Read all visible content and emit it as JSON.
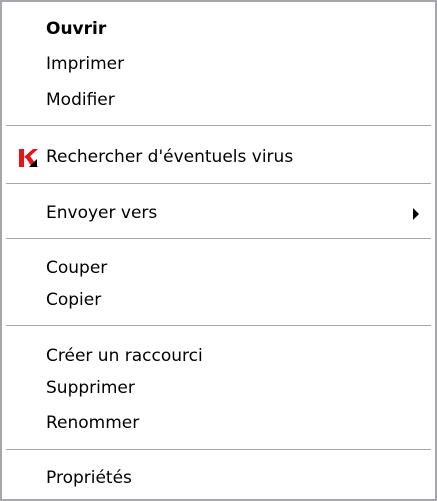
{
  "context_menu": {
    "items": [
      {
        "label": "Ouvrir"
      },
      {
        "label": "Imprimer"
      },
      {
        "label": "Modifier"
      },
      {
        "label": "Rechercher d'éventuels virus",
        "icon": "kaspersky-k-icon"
      },
      {
        "label": "Envoyer vers",
        "icon": "submenu-arrow-icon"
      },
      {
        "label": "Couper"
      },
      {
        "label": "Copier"
      },
      {
        "label": "Créer un raccourci"
      },
      {
        "label": "Supprimer"
      },
      {
        "label": "Renommer"
      },
      {
        "label": "Propriétés"
      }
    ]
  },
  "colors": {
    "border": "#a7a6aa",
    "separator": "#a7a6aa",
    "icon_red": "#e4141b",
    "icon_black": "#000000"
  }
}
